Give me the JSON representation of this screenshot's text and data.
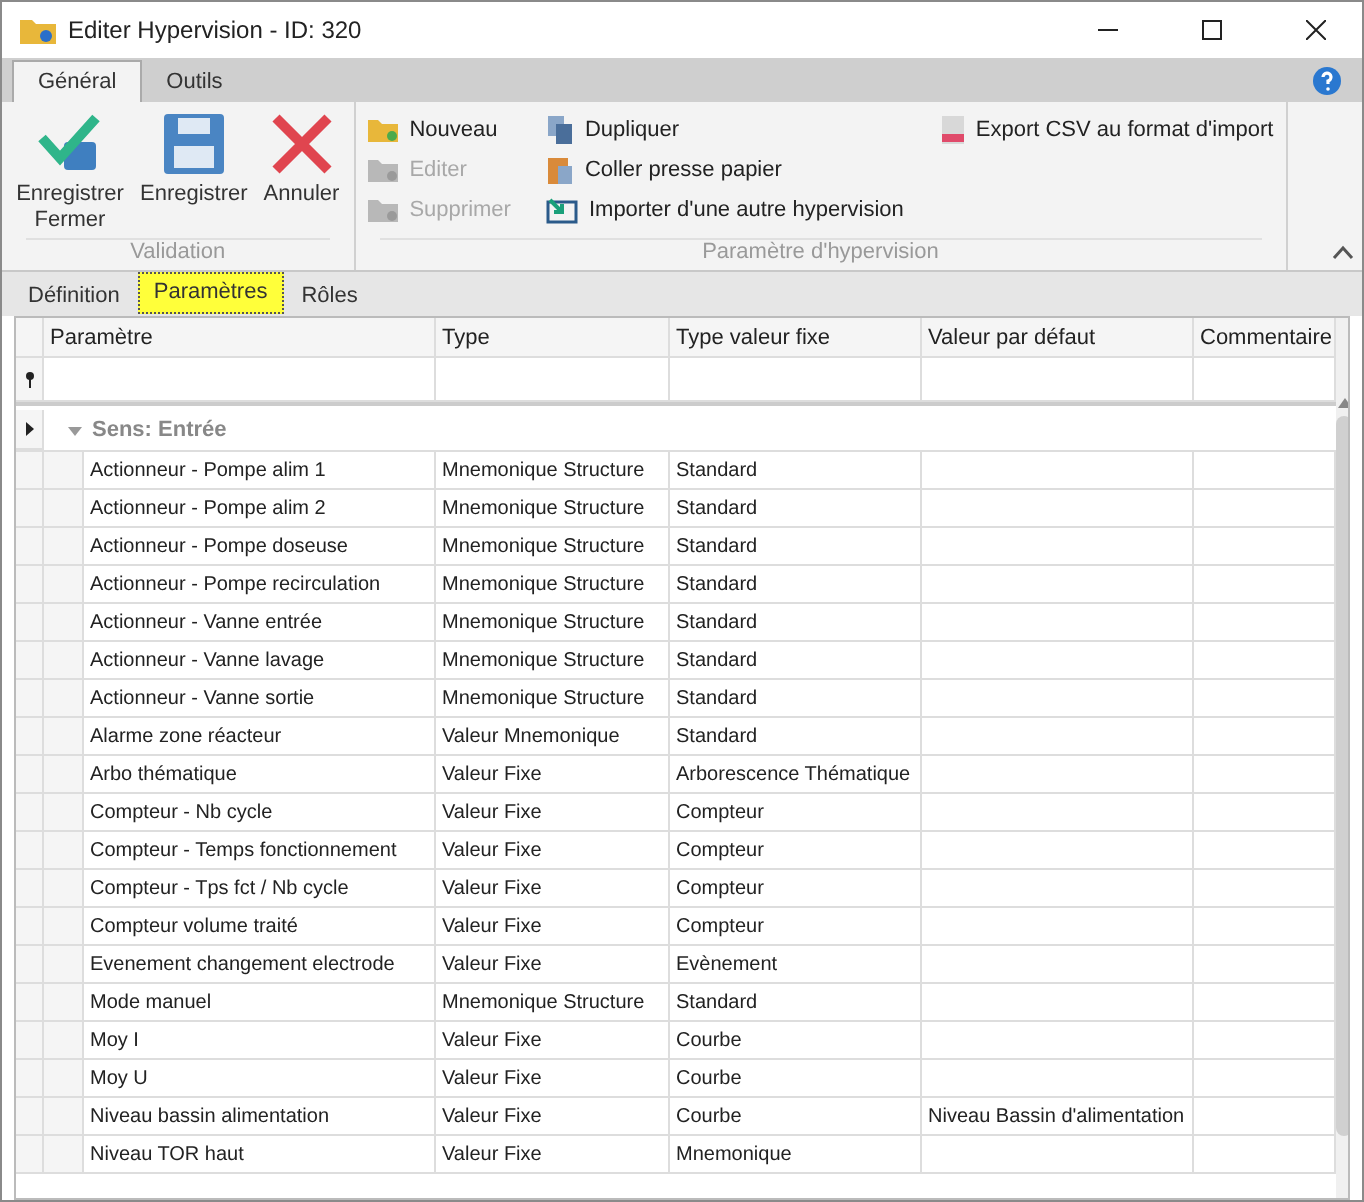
{
  "window": {
    "title": "Editer Hypervision - ID: 320"
  },
  "ribbon_tabs": [
    {
      "label": "Général",
      "selected": true
    },
    {
      "label": "Outils",
      "selected": false
    }
  ],
  "ribbon_groups": [
    {
      "label": "Validation",
      "kind": "large",
      "items": [
        {
          "label": "Enregistrer Fermer",
          "disabled": false
        },
        {
          "label": "Enregistrer",
          "disabled": false
        },
        {
          "label": "Annuler",
          "disabled": false
        }
      ]
    },
    {
      "label": "Paramètre d'hypervision",
      "kind": "small",
      "items": [
        {
          "label": "Nouveau",
          "disabled": false
        },
        {
          "label": "Editer",
          "disabled": true
        },
        {
          "label": "Supprimer",
          "disabled": true
        },
        {
          "label": "Dupliquer",
          "disabled": false
        },
        {
          "label": "Coller presse papier",
          "disabled": false
        },
        {
          "label": "Importer d'une autre hypervision",
          "disabled": false
        },
        {
          "label": "Export CSV au format d'import",
          "disabled": false
        }
      ]
    }
  ],
  "tabs": [
    {
      "label": "Définition",
      "selected": false
    },
    {
      "label": "Paramètres",
      "selected": true
    },
    {
      "label": "Rôles",
      "selected": false
    }
  ],
  "table": {
    "columns": [
      "Paramètre",
      "Type",
      "Type valeur fixe",
      "Valeur par défaut",
      "Commentaire"
    ],
    "group": {
      "label": "Sens: Entrée",
      "expanded": true
    },
    "rows": [
      [
        "Actionneur - Pompe alim 1",
        "Mnemonique Structure",
        "Standard",
        ""
      ],
      [
        "Actionneur - Pompe alim 2",
        "Mnemonique Structure",
        "Standard",
        ""
      ],
      [
        "Actionneur - Pompe doseuse",
        "Mnemonique Structure",
        "Standard",
        ""
      ],
      [
        "Actionneur - Pompe recirculation",
        "Mnemonique Structure",
        "Standard",
        ""
      ],
      [
        "Actionneur - Vanne entrée",
        "Mnemonique Structure",
        "Standard",
        ""
      ],
      [
        "Actionneur - Vanne lavage",
        "Mnemonique Structure",
        "Standard",
        ""
      ],
      [
        "Actionneur - Vanne sortie",
        "Mnemonique Structure",
        "Standard",
        ""
      ],
      [
        "Alarme zone réacteur",
        "Valeur Mnemonique",
        "Standard",
        ""
      ],
      [
        "Arbo thématique",
        "Valeur Fixe",
        "Arborescence Thématique",
        ""
      ],
      [
        "Compteur - Nb cycle",
        "Valeur Fixe",
        "Compteur",
        ""
      ],
      [
        "Compteur - Temps fonctionnement",
        "Valeur Fixe",
        "Compteur",
        ""
      ],
      [
        "Compteur - Tps fct / Nb cycle",
        "Valeur Fixe",
        "Compteur",
        ""
      ],
      [
        "Compteur volume traité",
        "Valeur Fixe",
        "Compteur",
        ""
      ],
      [
        "Evenement changement electrode",
        "Valeur Fixe",
        "Evènement",
        ""
      ],
      [
        "Mode manuel",
        "Mnemonique Structure",
        "Standard",
        ""
      ],
      [
        "Moy I",
        "Valeur Fixe",
        "Courbe",
        ""
      ],
      [
        "Moy U",
        "Valeur Fixe",
        "Courbe",
        ""
      ],
      [
        "Niveau bassin alimentation",
        "Valeur Fixe",
        "Courbe",
        "Niveau Bassin d'alimentation"
      ],
      [
        "Niveau TOR haut",
        "Valeur Fixe",
        "Mnemonique",
        ""
      ]
    ]
  }
}
